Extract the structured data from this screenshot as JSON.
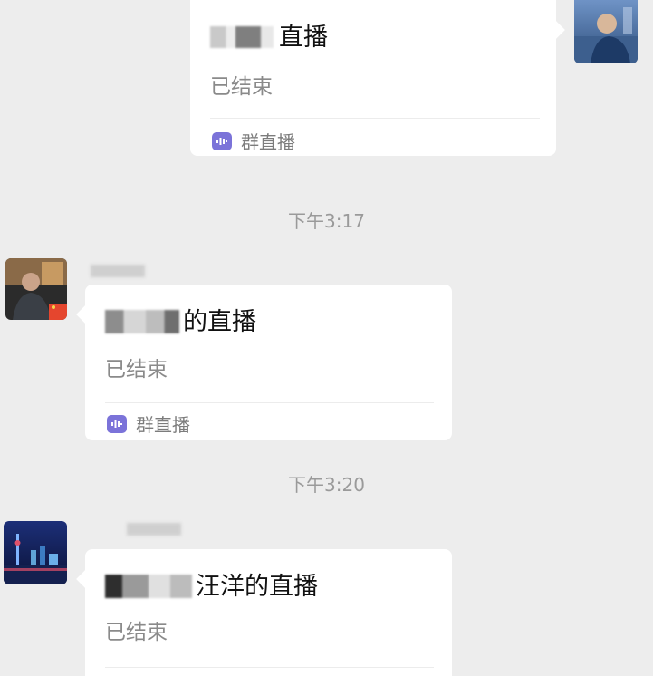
{
  "messages": [
    {
      "title_suffix": "直播",
      "status": "已结束",
      "footer_label": "群直播"
    },
    {
      "timestamp": "下午3:17",
      "title_suffix": "的直播",
      "status": "已结束",
      "footer_label": "群直播"
    },
    {
      "timestamp": "下午3:20",
      "title_suffix": "汪洋的直播",
      "status": "已结束"
    }
  ],
  "icons": {
    "live": "live-audio-icon",
    "flag": "flag-badge-icon"
  },
  "colors": {
    "background": "#ededed",
    "card": "#ffffff",
    "status_text": "#8a8a8a",
    "footer_icon": "#7b73d9"
  }
}
